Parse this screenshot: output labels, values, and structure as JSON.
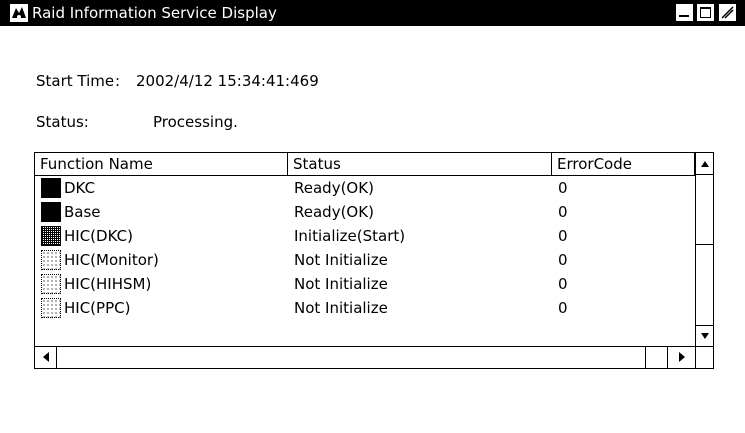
{
  "window": {
    "title": "Raid Information Service Display",
    "icons": {
      "app": "app-logo-icon",
      "minimize": "minimize-icon",
      "maximize": "maximize-icon",
      "close": "close-icon"
    }
  },
  "info": {
    "start_time_label": "Start Time",
    "start_time_sep": ":",
    "start_time_value": "2002/4/12 15:34:41:469",
    "status_label": "Status:",
    "status_value": "Processing."
  },
  "list": {
    "columns": [
      "Function Name",
      "Status",
      "ErrorCode"
    ],
    "rows": [
      {
        "icon": "solid-indicator-icon",
        "name": "DKC",
        "status": "Ready(OK)",
        "code": "0"
      },
      {
        "icon": "solid-indicator-icon",
        "name": "Base",
        "status": "Ready(OK)",
        "code": "0"
      },
      {
        "icon": "shaded-indicator-icon",
        "name": "HIC(DKC)",
        "status": "Initialize(Start)",
        "code": "0"
      },
      {
        "icon": "dotted-indicator-icon",
        "name": "HIC(Monitor)",
        "status": "Not Initialize",
        "code": "0"
      },
      {
        "icon": "dotted-indicator-icon",
        "name": "HIC(HIHSM)",
        "status": "Not Initialize",
        "code": "0"
      },
      {
        "icon": "dotted-indicator-icon",
        "name": "HIC(PPC)",
        "status": "Not Initialize",
        "code": "0"
      }
    ],
    "scroll_icons": {
      "up": "arrow-up-icon",
      "down": "arrow-down-icon",
      "left": "arrow-left-icon",
      "right": "arrow-right-icon"
    }
  }
}
